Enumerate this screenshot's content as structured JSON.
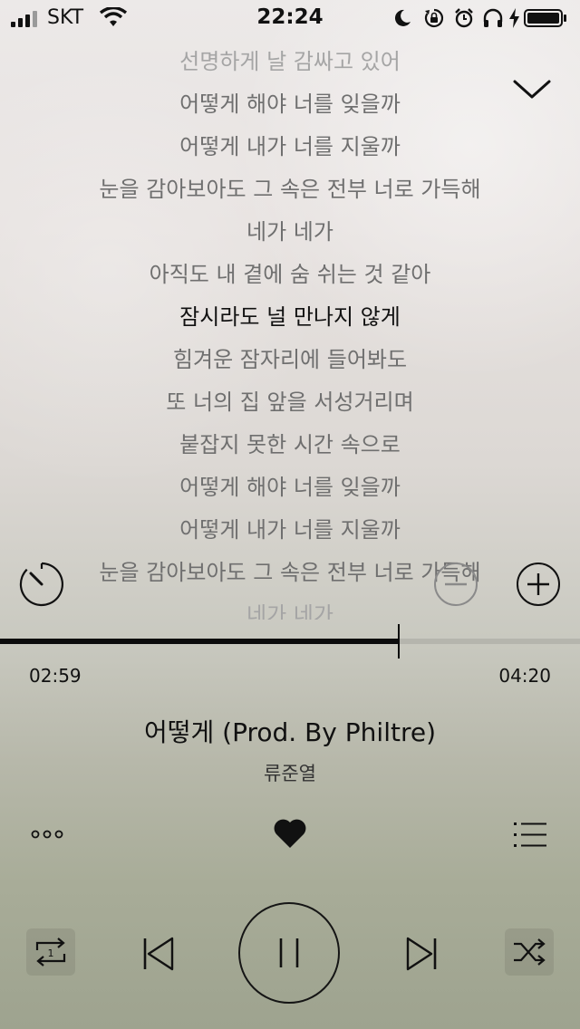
{
  "status_bar": {
    "carrier": "SKT",
    "time": "22:24",
    "icons": [
      "signal-icon",
      "wifi-icon",
      "moon-icon",
      "orientation-lock-icon",
      "alarm-icon",
      "headphones-icon",
      "battery-icon"
    ]
  },
  "lyrics": {
    "lines": [
      "선명하게 날 감싸고 있어",
      "어떻게 해야 너를 잊을까",
      "어떻게 내가 너를 지울까",
      "눈을 감아보아도 그 속은 전부 너로 가득해",
      "네가 네가",
      "아직도 내 곁에 숨 쉬는 것 같아",
      "잠시라도 널 만나지 않게",
      "힘겨운 잠자리에 들어봐도",
      "또 너의 집 앞을 서성거리며",
      "붙잡지 못한 시간 속으로",
      "어떻게 해야 너를 잊을까",
      "어떻게 내가 너를 지울까",
      "눈을 감아보아도 그 속은 전부 너로 가득해",
      "네가 네가"
    ],
    "active_index": 6
  },
  "player": {
    "elapsed": "02:59",
    "total": "04:20",
    "progress": 0.688,
    "title": "어떻게 (Prod. By Philtre)",
    "artist": "류준열",
    "liked": true,
    "repeat_mode": "1",
    "state": "playing"
  },
  "icons": {
    "collapse": "chevron-down-icon",
    "timer": "sleep-timer-icon",
    "zoom_out": "minus-circle-icon",
    "zoom_in": "plus-circle-icon",
    "more": "more-icon",
    "like": "heart-icon",
    "queue": "playlist-icon",
    "repeat": "repeat-one-icon",
    "previous": "skip-previous-icon",
    "pause": "pause-icon",
    "next": "skip-next-icon",
    "shuffle": "shuffle-icon"
  },
  "colors": {
    "text": "#111111",
    "lyric_inactive": "#6f6f6f",
    "track": "#b5b5ad",
    "track_fill": "#0c0c0c"
  }
}
